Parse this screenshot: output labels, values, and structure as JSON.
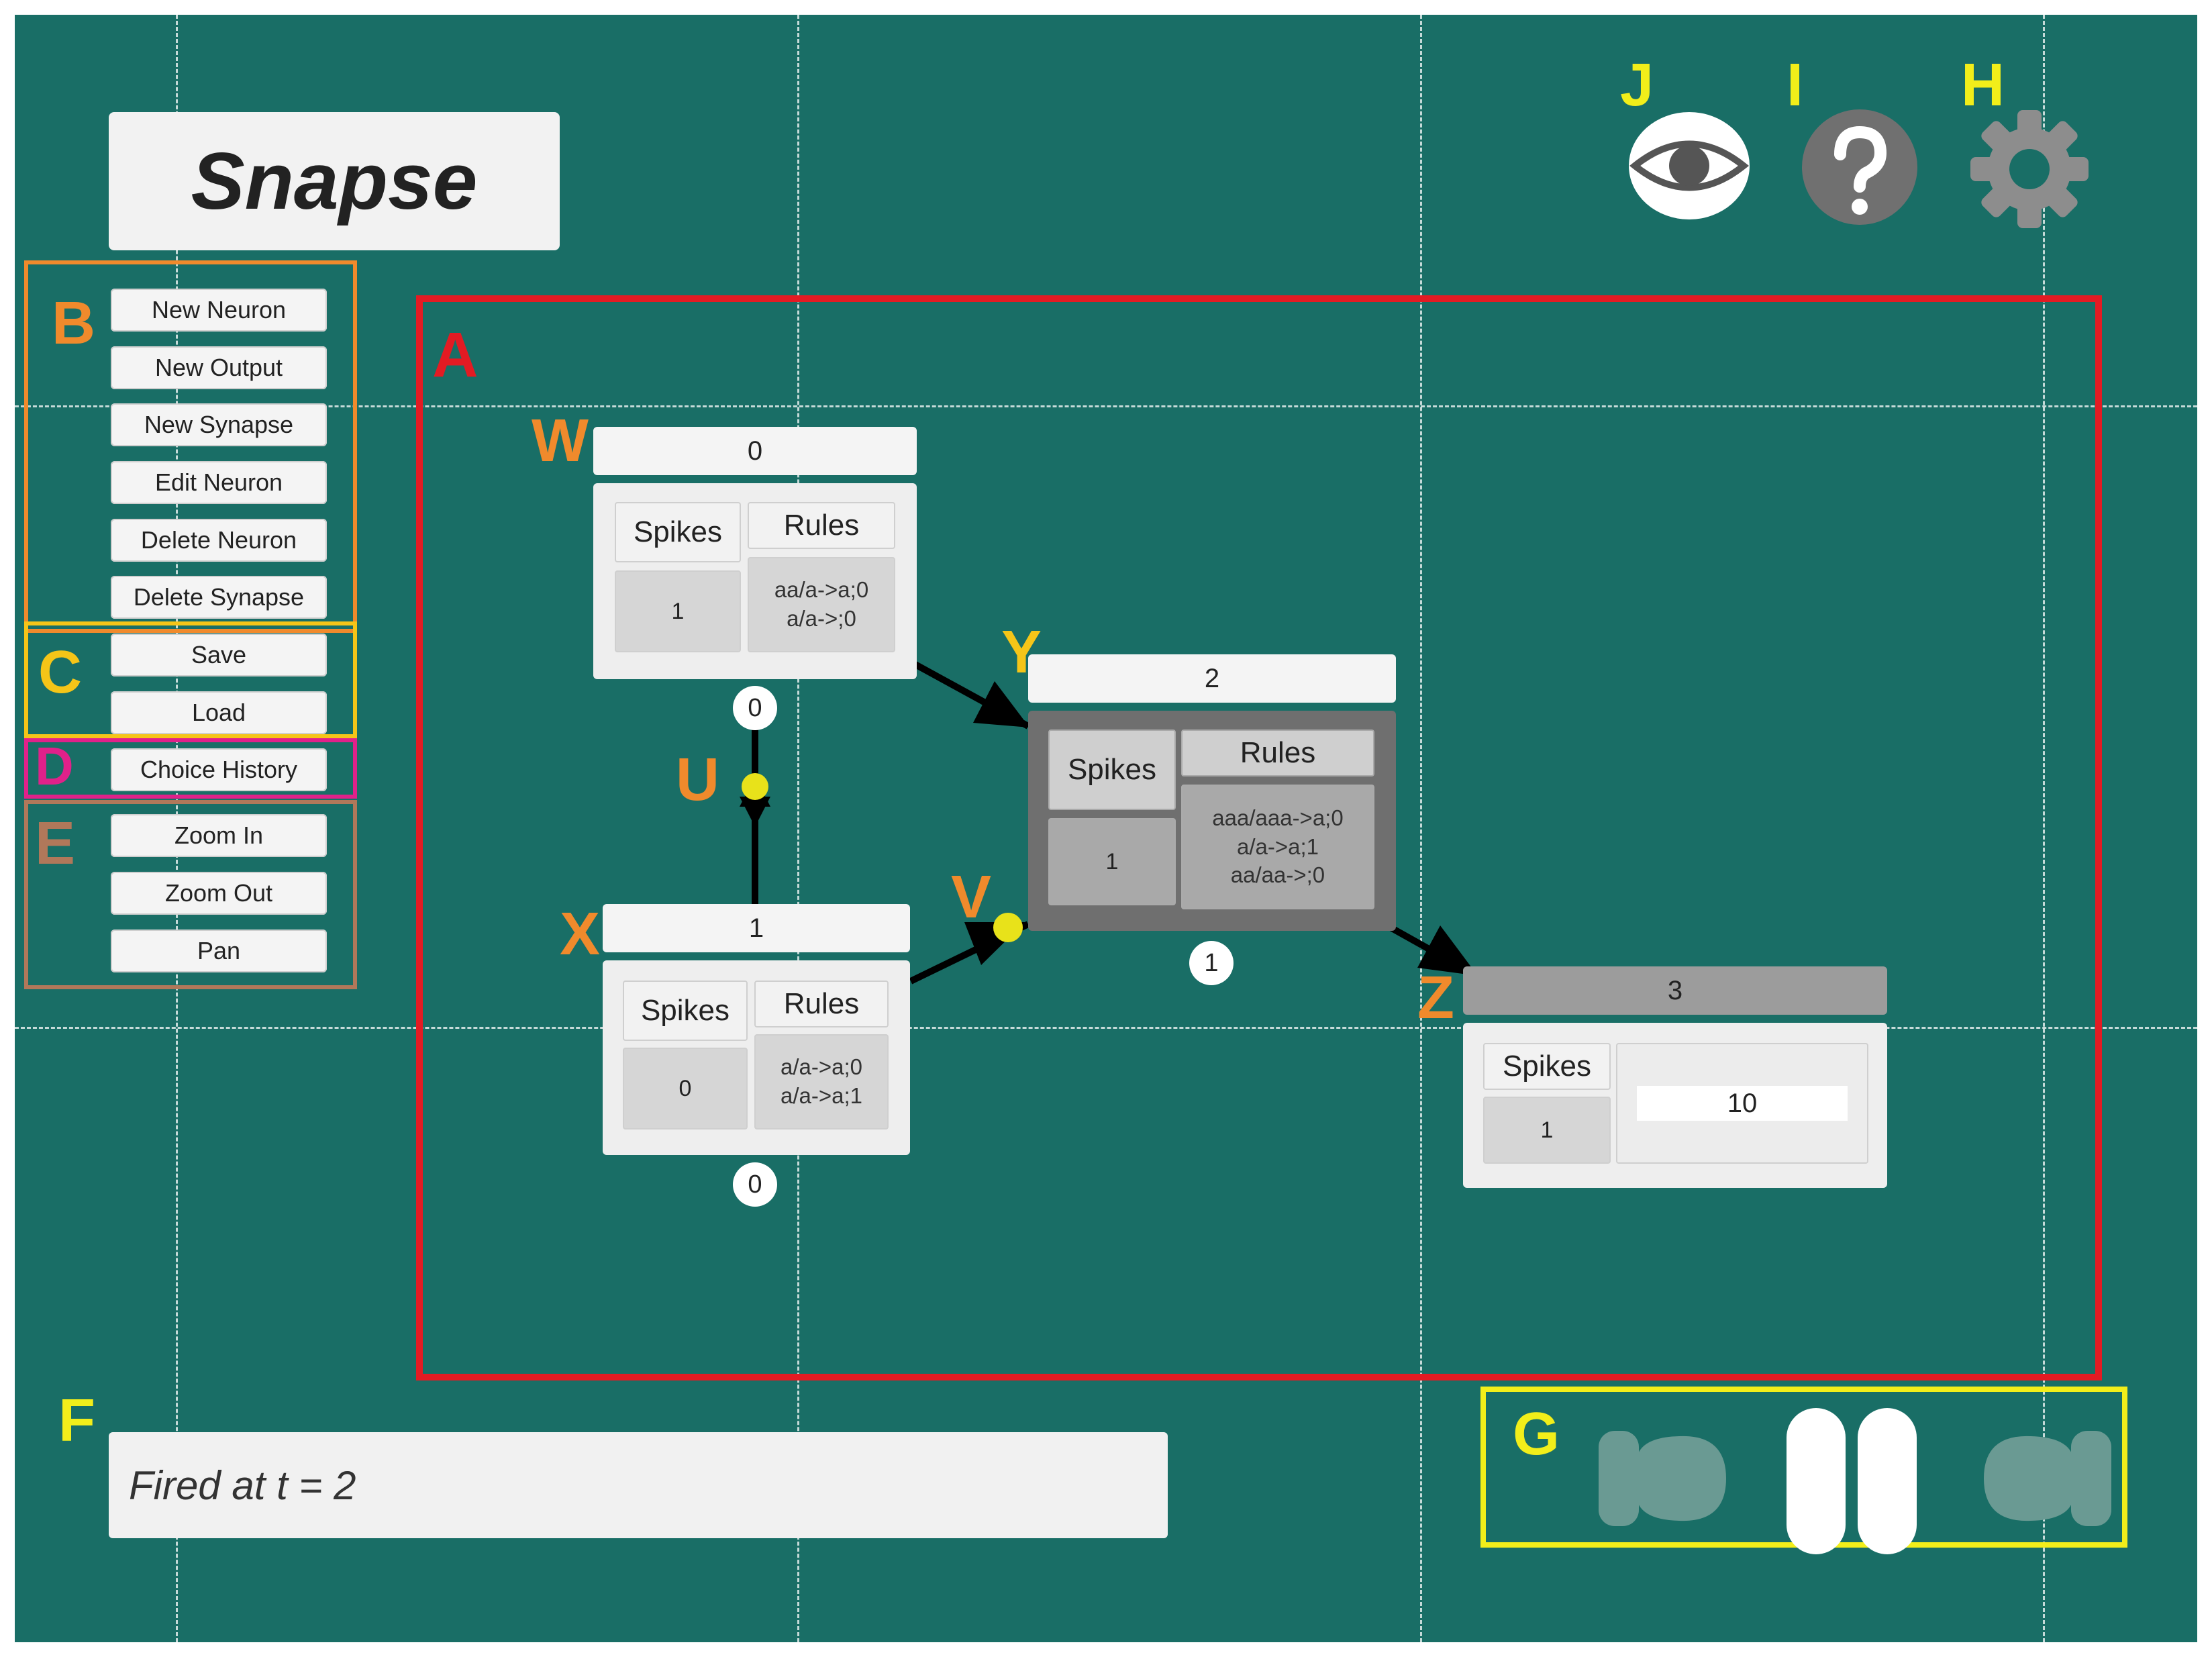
{
  "app": {
    "title": "Snapse"
  },
  "labels": {
    "A": "A",
    "B": "B",
    "C": "C",
    "D": "D",
    "E": "E",
    "F": "F",
    "G": "G",
    "H": "H",
    "I": "I",
    "J": "J",
    "U": "U",
    "V": "V",
    "W": "W",
    "X": "X",
    "Y": "Y",
    "Z": "Z"
  },
  "colors": {
    "background": "#196e66",
    "frame_A": "#e31b23",
    "frame_B": "#f08a2c",
    "frame_C": "#f5c518",
    "frame_D": "#e0218a",
    "frame_E": "#b0785a",
    "frame_G": "#f2ee1a",
    "label_orange": "#f08a2c",
    "label_yellow": "#f2ee1a"
  },
  "toolbar": {
    "new_neuron": "New Neuron",
    "new_output": "New Output",
    "new_synapse": "New Synapse",
    "edit_neuron": "Edit Neuron",
    "delete_neuron": "Delete Neuron",
    "delete_synapse": "Delete Synapse",
    "save": "Save",
    "load": "Load",
    "choice_history": "Choice History",
    "zoom_in": "Zoom In",
    "zoom_out": "Zoom Out",
    "pan": "Pan"
  },
  "top_icons": [
    "eye-icon",
    "help-icon",
    "gear-icon"
  ],
  "neurons": {
    "w": {
      "id": "0",
      "spikes_label": "Spikes",
      "rules_label": "Rules",
      "spikes": "1",
      "rules": [
        "aa/a->a;0",
        "a/a->;0"
      ]
    },
    "x": {
      "id": "1",
      "spikes_label": "Spikes",
      "rules_label": "Rules",
      "spikes": "0",
      "rules": [
        "a/a->a;0",
        "a/a->a;1"
      ]
    },
    "y": {
      "id": "2",
      "spikes_label": "Spikes",
      "rules_label": "Rules",
      "spikes": "1",
      "rules": [
        "aaa/aaa->a;0",
        "a/a->a;1",
        "aa/aa->;0"
      ]
    },
    "z": {
      "id": "3",
      "spikes_label": "Spikes",
      "spikes": "1",
      "output": "10"
    }
  },
  "synapse_counters": {
    "w_top": "0",
    "x_bottom": "0",
    "y_bottom": "1"
  },
  "status": {
    "message": "Fired at t = 2"
  },
  "playback": {
    "icons": [
      "step-back-icon",
      "pause-icon",
      "step-forward-icon"
    ]
  }
}
